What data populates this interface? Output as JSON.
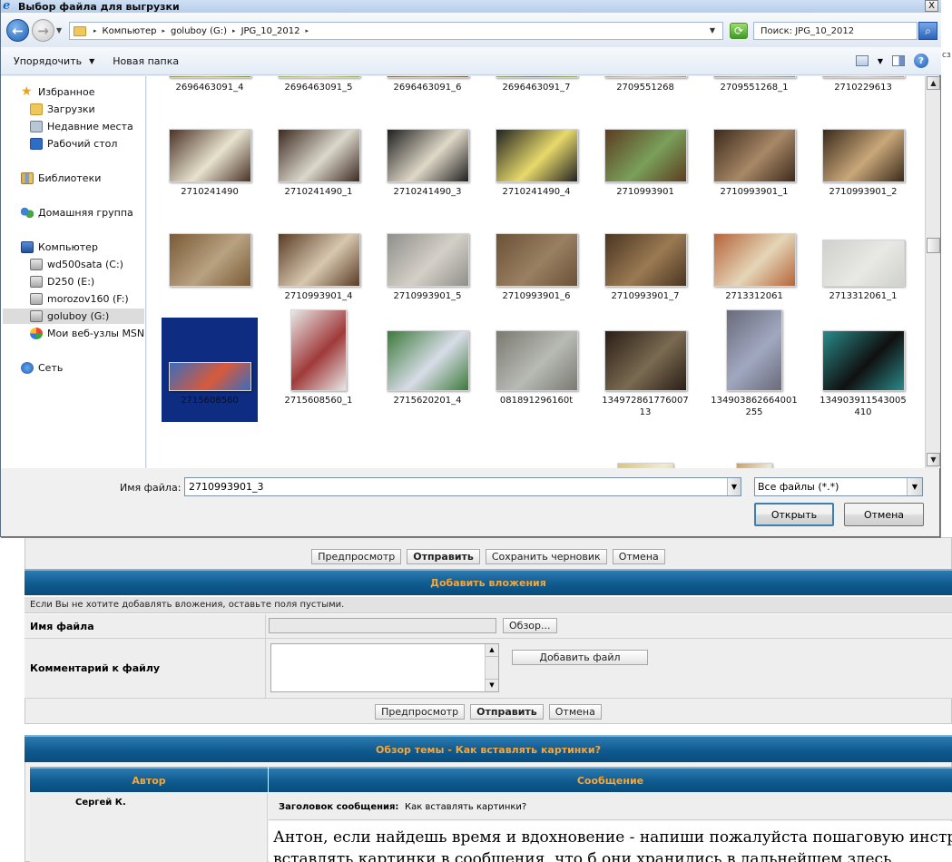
{
  "dialog": {
    "title": "Выбор файла для выгрузки",
    "close_label": "X",
    "address": [
      "Компьютер",
      "goluboy (G:)",
      "JPG_10_2012"
    ],
    "search_text": "Поиск: JPG_10_2012",
    "toolbar": {
      "organize": "Упорядочить",
      "new_folder": "Новая папка"
    },
    "nav": {
      "favorites": "Избранное",
      "downloads": "Загрузки",
      "recent": "Недавние места",
      "desktop": "Рабочий стол",
      "libraries": "Библиотеки",
      "homegroup": "Домашняя группа",
      "computer": "Компьютер",
      "drive_c": "wd500sata (C:)",
      "drive_e": "D250 (E:)",
      "drive_f": "morozov160 (F:)",
      "drive_g": "goluboy (G:)",
      "msn": "Мои веб-узлы MSN",
      "network": "Сеть"
    },
    "files": [
      {
        "name": "2696463091_4",
        "c1": "#7a8a3a",
        "c2": "#c7b27a"
      },
      {
        "name": "2696463091_5",
        "c1": "#8aa54a",
        "c2": "#d7c99a"
      },
      {
        "name": "2696463091_6",
        "c1": "#6a5a3a",
        "c2": "#a89070"
      },
      {
        "name": "2696463091_7",
        "c1": "#9ab05a",
        "c2": "#7a7a7a"
      },
      {
        "name": "2709551268",
        "c1": "#a5917a",
        "c2": "#d8d0c0"
      },
      {
        "name": "2709551268_1",
        "c1": "#8f8f8f",
        "c2": "#c0b8a8"
      },
      {
        "name": "2710229613",
        "c1": "#b09a8a",
        "c2": "#d8c8c8"
      },
      {
        "name": "2710241490",
        "c1": "#4a3226",
        "c2": "#e8e2cf"
      },
      {
        "name": "2710241490_1",
        "c1": "#3d2a20",
        "c2": "#dcd8cc"
      },
      {
        "name": "2710241490_3",
        "c1": "#1f1f1f",
        "c2": "#e0d8c8"
      },
      {
        "name": "2710241490_4",
        "c1": "#222222",
        "c2": "#e7d96a"
      },
      {
        "name": "2710993901",
        "c1": "#5c3c22",
        "c2": "#7aa05a"
      },
      {
        "name": "2710993901_1",
        "c1": "#3d2a1c",
        "c2": "#a88866"
      },
      {
        "name": "2710993901_2",
        "c1": "#3a2a1a",
        "c2": "#c9a77a"
      },
      {
        "name": "2710993901_3",
        "c1": "#7a5a36",
        "c2": "#b8a282"
      },
      {
        "name": "2710993901_4",
        "c1": "#5a3c24",
        "c2": "#d8c8b0"
      },
      {
        "name": "2710993901_5",
        "c1": "#8f8f8a",
        "c2": "#d4d0c8"
      },
      {
        "name": "2710993901_6",
        "c1": "#6a5238",
        "c2": "#9a8062"
      },
      {
        "name": "2710993901_7",
        "c1": "#4a3522",
        "c2": "#9a7a52"
      },
      {
        "name": "2713312061",
        "c1": "#b5643a",
        "c2": "#e5d6b8"
      },
      {
        "name": "2713312061_1",
        "c1": "#cfd1cc",
        "c2": "#e8e8e4"
      },
      {
        "name": "2715608560",
        "c1": "#3a6cc0",
        "c2": "#d85a3a"
      },
      {
        "name": "2715608560_1",
        "c1": "#e8e8e8",
        "c2": "#a03a3a"
      },
      {
        "name": "2715620201_4",
        "c1": "#3c7a3a",
        "c2": "#d8dce8"
      },
      {
        "name": "081891296160t",
        "c1": "#7a7a72",
        "c2": "#b8bab4"
      },
      {
        "name": "134972861776007 13",
        "c1": "#2a1e16",
        "c2": "#7a6a52"
      },
      {
        "name": "134903862664001 255",
        "c1": "#6a6a7a",
        "c2": "#a0a8c0"
      },
      {
        "name": "134903911543005 410",
        "c1": "#2a8a8a",
        "c2": "#101010"
      },
      {
        "name": "",
        "c1": "#2a2a2a",
        "c2": "#e8e8e8"
      },
      {
        "name": "",
        "c1": "#5a3a22",
        "c2": "#b89a6a"
      },
      {
        "name": "",
        "c1": "#e8e0c8",
        "c2": "#b0a890"
      },
      {
        "name": "",
        "c1": "#e8e2cc",
        "c2": "#a89a80"
      },
      {
        "name": "",
        "c1": "#d8c47a",
        "c2": "#f2ead0"
      },
      {
        "name": "",
        "c1": "#c8a060",
        "c2": "#f0e8d8"
      },
      {
        "name": "",
        "c1": "#b07a3a",
        "c2": "#e0b06a"
      }
    ],
    "selected_index": 14,
    "filename_label": "Имя файла:",
    "filename_value": "2710993901_3",
    "filetype_value": "Все файлы (*.*)",
    "open_button": "Открыть",
    "cancel_button": "Отмена"
  },
  "forum": {
    "buttons_top": [
      "Предпросмотр",
      "Отправить",
      "Сохранить черновик",
      "Отмена"
    ],
    "attach_header": "Добавить вложения",
    "attach_note": "Если Вы не хотите добавлять вложения, оставьте поля пустыми.",
    "filename_label": "Имя файла",
    "browse_button": "Обзор...",
    "comment_label": "Комментарий к файлу",
    "add_file_button": "Добавить файл",
    "buttons_bottom": [
      "Предпросмотр",
      "Отправить",
      "Отмена"
    ],
    "topic_header": "Обзор темы - Как вставлять картинки?",
    "col_author": "Автор",
    "col_message": "Сообщение",
    "post_author": "Сергей К.",
    "post_subject_label": "Заголовок сообщения:",
    "post_subject": "Как вставлять картинки?",
    "post_body_1": "Антон, если найдешь время и вдохновение - напиши пожалуйста пошаговую инструкцию,",
    "post_body_2": "вставлять картинки в сообщения, что б они хранились в дальнейшем здесь"
  }
}
